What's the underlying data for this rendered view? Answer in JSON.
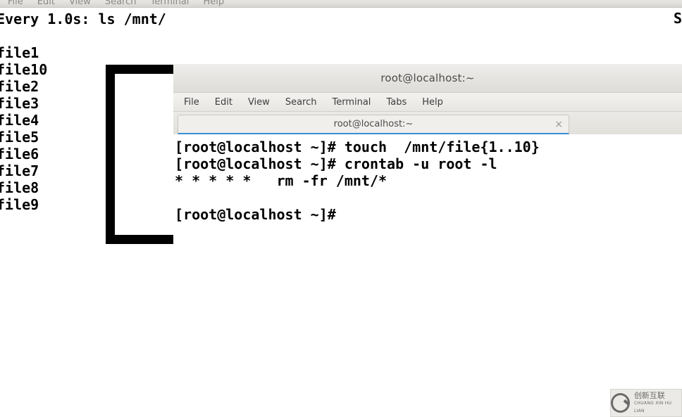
{
  "bg_menu": {
    "items": [
      "File",
      "Edit",
      "View",
      "Search",
      "Terminal",
      "Help"
    ]
  },
  "bg_watch": {
    "header_left": "Every 1.0s: ls /mnt/",
    "header_right": "S",
    "files": [
      "file1",
      "file10",
      "file2",
      "file3",
      "file4",
      "file5",
      "file6",
      "file7",
      "file8",
      "file9"
    ]
  },
  "fg": {
    "title": "root@localhost:~",
    "menu": [
      "File",
      "Edit",
      "View",
      "Search",
      "Terminal",
      "Tabs",
      "Help"
    ],
    "tab_label": "root@localhost:~",
    "tab_close": "×",
    "lines": [
      "[root@localhost ~]# touch  /mnt/file{1..10}",
      "[root@localhost ~]# crontab -u root -l",
      "* * * * *   rm -fr /mnt/*",
      "",
      "[root@localhost ~]# "
    ]
  },
  "watermark": {
    "line1": "创新互联",
    "line2": "CHUANG XIN HU LIAN"
  }
}
